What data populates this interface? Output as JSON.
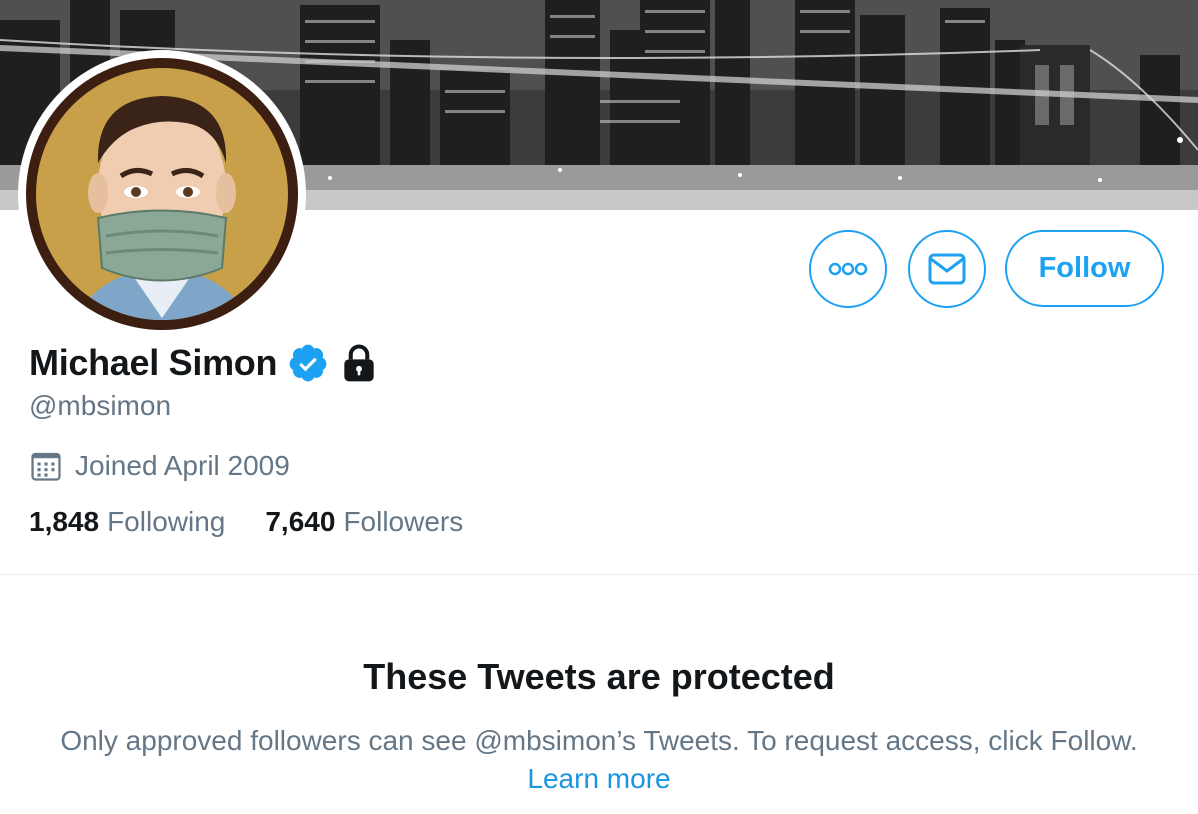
{
  "profile": {
    "name": "Michael Simon",
    "handle": "@mbsimon",
    "joined": "Joined April 2009",
    "following_count": "1,848",
    "following_label": "Following",
    "followers_count": "7,640",
    "followers_label": "Followers",
    "verified": true,
    "protected": true
  },
  "actions": {
    "more_icon": "more-icon",
    "message_icon": "mail-icon",
    "follow_label": "Follow"
  },
  "protected_notice": {
    "title": "These Tweets are protected",
    "body": "Only approved followers can see @mbsimon’s Tweets. To request access, click Follow.",
    "link": "Learn more"
  },
  "colors": {
    "accent": "#1da1f2",
    "link": "#1b95e0",
    "secondary_text": "#657786",
    "primary_text": "#14171a"
  }
}
